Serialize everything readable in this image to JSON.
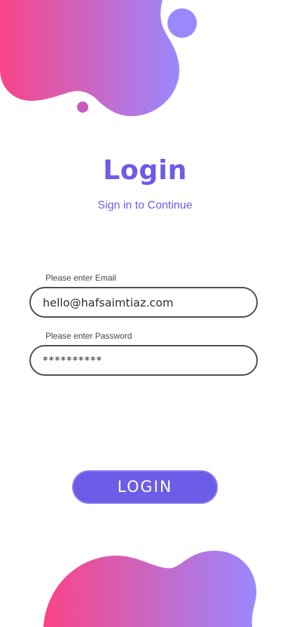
{
  "header": {
    "title": "Login",
    "subtitle": "Sign in to Continue"
  },
  "form": {
    "email_label": "Please enter Email",
    "email_value": "hello@hafsaimtiaz.com",
    "password_label": "Please enter Password",
    "password_value": "**********",
    "submit_label": "LOGIN"
  },
  "colors": {
    "accent": "#6c5ce7",
    "gradient_start": "#fa4487",
    "gradient_end": "#9a88ff",
    "dot_purple": "#9a88ff",
    "dot_magenta": "#c75cbe"
  }
}
